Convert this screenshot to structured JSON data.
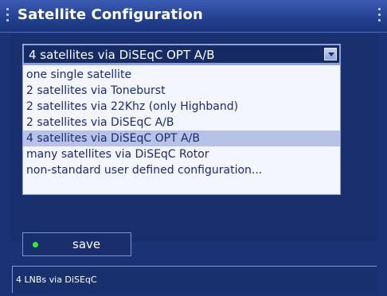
{
  "window": {
    "title": "Satellite Configuration"
  },
  "config_select": {
    "selected": "4 satellites via DiSEqC OPT A/B",
    "options": [
      "one single satellite",
      "2 satellites via Toneburst",
      "2 satellites via 22Khz (only Highband)",
      "2 satellites via DiSEqC A/B",
      "4 satellites via DiSEqC OPT A/B",
      "many satellites via DiSEqC Rotor",
      "non-standard user defined configuration..."
    ],
    "highlighted_index": 4
  },
  "save_button": {
    "label": "save",
    "indicator_color": "#2ef12c"
  },
  "status_bar": {
    "text": "4 LNBs via DiSEqC"
  },
  "colors": {
    "background": "#1b3277",
    "dropdown_bg": "#f3f5ff",
    "highlight": "#b7c2e6",
    "text_dark": "#1a2b74"
  }
}
